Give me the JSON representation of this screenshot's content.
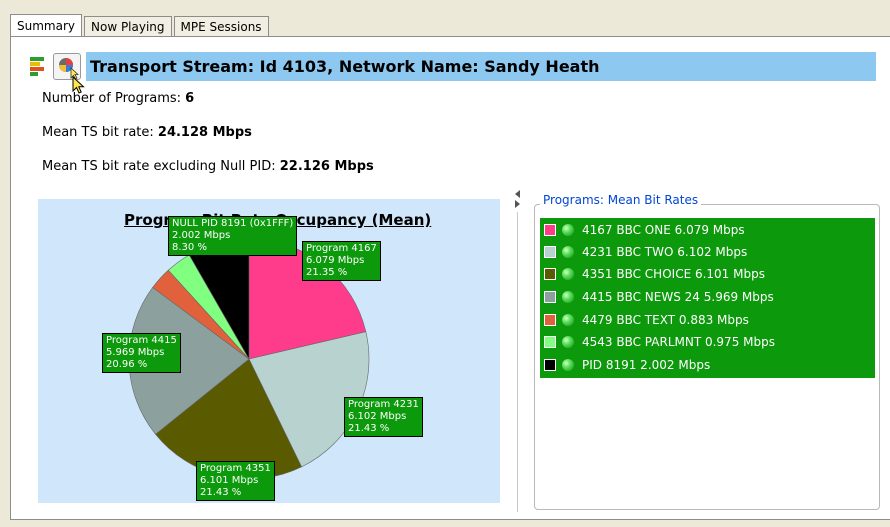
{
  "tabs": [
    {
      "label": "Summary",
      "active": true
    },
    {
      "label": "Now Playing",
      "active": false
    },
    {
      "label": "MPE Sessions",
      "active": false
    }
  ],
  "header": {
    "title": "Transport Stream: Id 4103, Network Name: Sandy Heath",
    "legend_icon": "bar-legend-icon",
    "pie_button_icon": "pie-chart-icon",
    "title_bar_color": "#8cc8ef"
  },
  "summary": {
    "programs_label": "Number of Programs:",
    "programs_value": "6",
    "mean_label": "Mean TS bit rate:",
    "mean_value": "24.128 Mbps",
    "mean_excl_label": "Mean TS bit rate excluding Null PID:",
    "mean_excl_value": "22.126 Mbps"
  },
  "chart_data": {
    "type": "pie",
    "title": "Program Bit Rate Occupancy (Mean)",
    "slices": [
      {
        "label_lines": [
          "Program 4167",
          "6.079 Mbps",
          "21.35 %"
        ],
        "value": 21.35,
        "color": "#ff3c8c"
      },
      {
        "label_lines": [
          "Program 4231",
          "6.102 Mbps",
          "21.43 %"
        ],
        "value": 21.43,
        "color": "#b8d3cf"
      },
      {
        "label_lines": [
          "Program 4351",
          "6.101 Mbps",
          "21.43 %"
        ],
        "value": 21.43,
        "color": "#5a5a00"
      },
      {
        "label_lines": [
          "Program 4415",
          "5.969 Mbps",
          "20.96 %"
        ],
        "value": 20.96,
        "color": "#8ca19d"
      },
      {
        "label_lines": [],
        "value": 3.1,
        "color": "#e0613c"
      },
      {
        "label_lines": [],
        "value": 3.43,
        "color": "#80ff80"
      },
      {
        "label_lines": [
          "NULL PID 8191 (0x1FFF)",
          "2.002 Mbps",
          "8.30 %"
        ],
        "value": 8.3,
        "color": "#000000"
      }
    ],
    "label_color": "#0c9a0c",
    "background": "#cfe6fb"
  },
  "programs_panel": {
    "title": "Programs: Mean Bit Rates",
    "items": [
      {
        "text": "4167 BBC ONE    6.079 Mbps",
        "color": "#ff3c8c"
      },
      {
        "text": "4231 BBC TWO    6.102 Mbps",
        "color": "#b8d3cf"
      },
      {
        "text": "4351 BBC CHOICE    6.101 Mbps",
        "color": "#5a5a00"
      },
      {
        "text": "4415 BBC NEWS 24    5.969 Mbps",
        "color": "#8ca19d"
      },
      {
        "text": "4479 BBC TEXT    0.883 Mbps",
        "color": "#e0613c"
      },
      {
        "text": "4543 BBC PARLMNT    0.975 Mbps",
        "color": "#80ff80"
      },
      {
        "text": "PID 8191 2.002 Mbps",
        "color": "#000000"
      }
    ],
    "list_background": "#0c9a0c"
  }
}
